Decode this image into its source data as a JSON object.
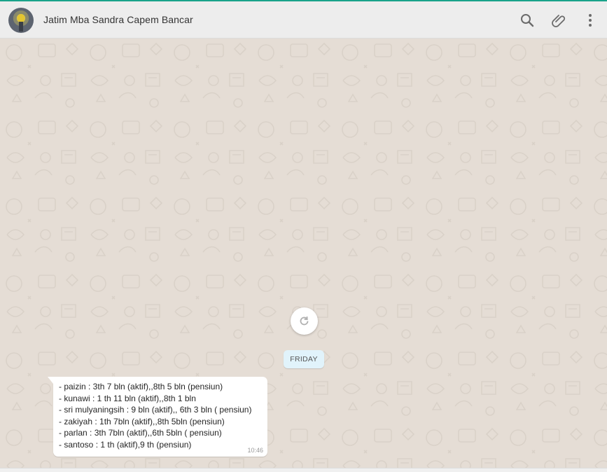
{
  "header": {
    "contact_name": "Jatim Mba Sandra Capem Bancar",
    "icons": [
      "search-icon",
      "attach-icon",
      "menu-icon"
    ]
  },
  "chat": {
    "day_label": "FRIDAY",
    "message": {
      "lines": [
        "- paizin : 3th 7 bln (aktif),,8th 5 bln (pensiun)",
        "- kunawi : 1 th 11 bln (aktif),,8th 1 bln",
        "- sri mulyaningsih : 9 bln (aktif),, 6th 3 bln ( pensiun)",
        "- zakiyah : 1th 7bln (aktif),,8th 5bln (pensiun)",
        "- parlan : 3th 7bln (aktif),,6th 5bln ( pensiun)",
        "- santoso : 1 th (aktif),9 th (pensiun)"
      ],
      "time": "10:46"
    }
  },
  "colors": {
    "accent": "#19a38a",
    "header_bg": "#ededed",
    "chat_bg": "#e5ddd5",
    "bubble_bg": "#ffffff",
    "day_badge_bg": "#e1f3fb"
  }
}
